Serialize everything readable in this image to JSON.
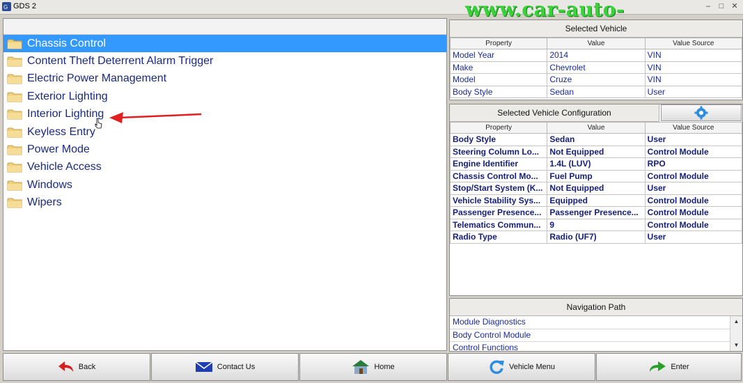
{
  "window": {
    "title": "GDS 2"
  },
  "watermark": "www.car-auto-repair.com",
  "tree": {
    "items": [
      "Chassis Control",
      "Content Theft Deterrent Alarm Trigger",
      "Electric Power Management",
      "Exterior Lighting",
      "Interior Lighting",
      "Keyless Entry",
      "Power Mode",
      "Vehicle Access",
      "Windows",
      "Wipers"
    ],
    "selected_index": 0
  },
  "selected_vehicle": {
    "title": "Selected Vehicle",
    "headers": [
      "Property",
      "Value",
      "Value Source"
    ],
    "rows": [
      [
        "Model Year",
        "2014",
        "VIN"
      ],
      [
        "Make",
        "Chevrolet",
        "VIN"
      ],
      [
        "Model",
        "Cruze",
        "VIN"
      ],
      [
        "Body Style",
        "Sedan",
        "User"
      ]
    ]
  },
  "vehicle_config": {
    "title": "Selected Vehicle Configuration",
    "headers": [
      "Property",
      "Value",
      "Value Source"
    ],
    "rows": [
      [
        "Body Style",
        "Sedan",
        "User"
      ],
      [
        "Steering Column Lo...",
        "Not Equipped",
        "Control Module"
      ],
      [
        "Engine Identifier",
        "1.4L (LUV)",
        "RPO"
      ],
      [
        "Chassis Control Mo...",
        "Fuel Pump",
        "Control Module"
      ],
      [
        "Stop/Start System (K...",
        "Not Equipped",
        "User"
      ],
      [
        "Vehicle Stability Sys...",
        "Equipped",
        "Control Module"
      ],
      [
        "Passenger Presence...",
        "Passenger Presence...",
        "Control Module"
      ],
      [
        "Telematics Commun...",
        "9",
        "Control Module"
      ],
      [
        "Radio Type",
        "Radio (UF7)",
        "User"
      ]
    ]
  },
  "navigation": {
    "title": "Navigation Path",
    "items": [
      "Module Diagnostics",
      "Body Control Module",
      "Control Functions"
    ]
  },
  "buttons": {
    "back": "Back",
    "contact": "Contact Us",
    "home": "Home",
    "vehicle_menu": "Vehicle Menu",
    "enter": "Enter"
  },
  "colors": {
    "selection": "#3399ff",
    "link_text": "#1a2a9a",
    "annotation_arrow": "#e02020",
    "watermark": "#3ad23a"
  }
}
